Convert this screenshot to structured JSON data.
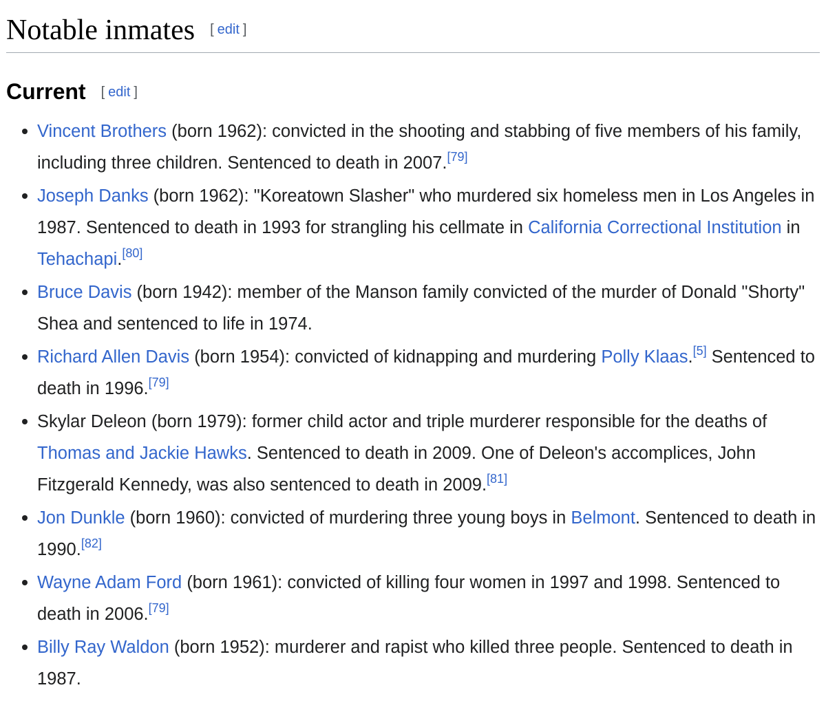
{
  "heading": {
    "title": "Notable inmates",
    "edit_open": "[",
    "edit_label": "edit",
    "edit_close": "]"
  },
  "subheading": {
    "title": "Current",
    "edit_open": "[",
    "edit_label": "edit",
    "edit_close": "]"
  },
  "inmates": [
    {
      "name": "Vincent Brothers",
      "t1": " (born 1962): convicted in the shooting and stabbing of five members of his family, including three children. Sentenced to death in 2007.",
      "ref1": "[79]"
    },
    {
      "name": "Joseph Danks",
      "t1": " (born 1962): \"Koreatown Slasher\" who murdered six homeless men in Los Angeles in 1987. Sentenced to death in 1993 for strangling his cellmate in ",
      "link1": "California Correctional Institution",
      "t2": " in ",
      "link2": "Tehachapi",
      "t3": ".",
      "ref1": "[80]"
    },
    {
      "name": "Bruce Davis",
      "t1": " (born 1942): member of the Manson family convicted of the murder of Donald \"Shorty\" Shea and sentenced to life in 1974."
    },
    {
      "name": "Richard Allen Davis",
      "t1": " (born 1954): convicted of kidnapping and murdering ",
      "link1": "Polly Klaas",
      "t2": ".",
      "ref1": "[5]",
      "t3": " Sentenced to death in 1996.",
      "ref2": "[79]"
    },
    {
      "t0": "Skylar Deleon (born 1979): former child actor and triple murderer responsible for the deaths of ",
      "link1": "Thomas and Jackie Hawks",
      "t1": ". Sentenced to death in 2009. One of Deleon's accomplices, John Fitzgerald Kennedy, was also sentenced to death in 2009.",
      "ref1": "[81]"
    },
    {
      "name": "Jon Dunkle",
      "t1": " (born 1960): convicted of murdering three young boys in ",
      "link1": "Belmont",
      "t2": ". Sentenced to death in 1990.",
      "ref1": "[82]"
    },
    {
      "name": "Wayne Adam Ford",
      "t1": " (born 1961): convicted of killing four women in 1997 and 1998. Sentenced to death in 2006.",
      "ref1": "[79]"
    },
    {
      "name": "Billy Ray Waldon",
      "t1": " (born 1952): murderer and rapist who killed three people. Sentenced to death in 1987."
    }
  ],
  "colors": {
    "link": "#3366cc",
    "text": "#202122",
    "rule": "#a2a9b1"
  }
}
